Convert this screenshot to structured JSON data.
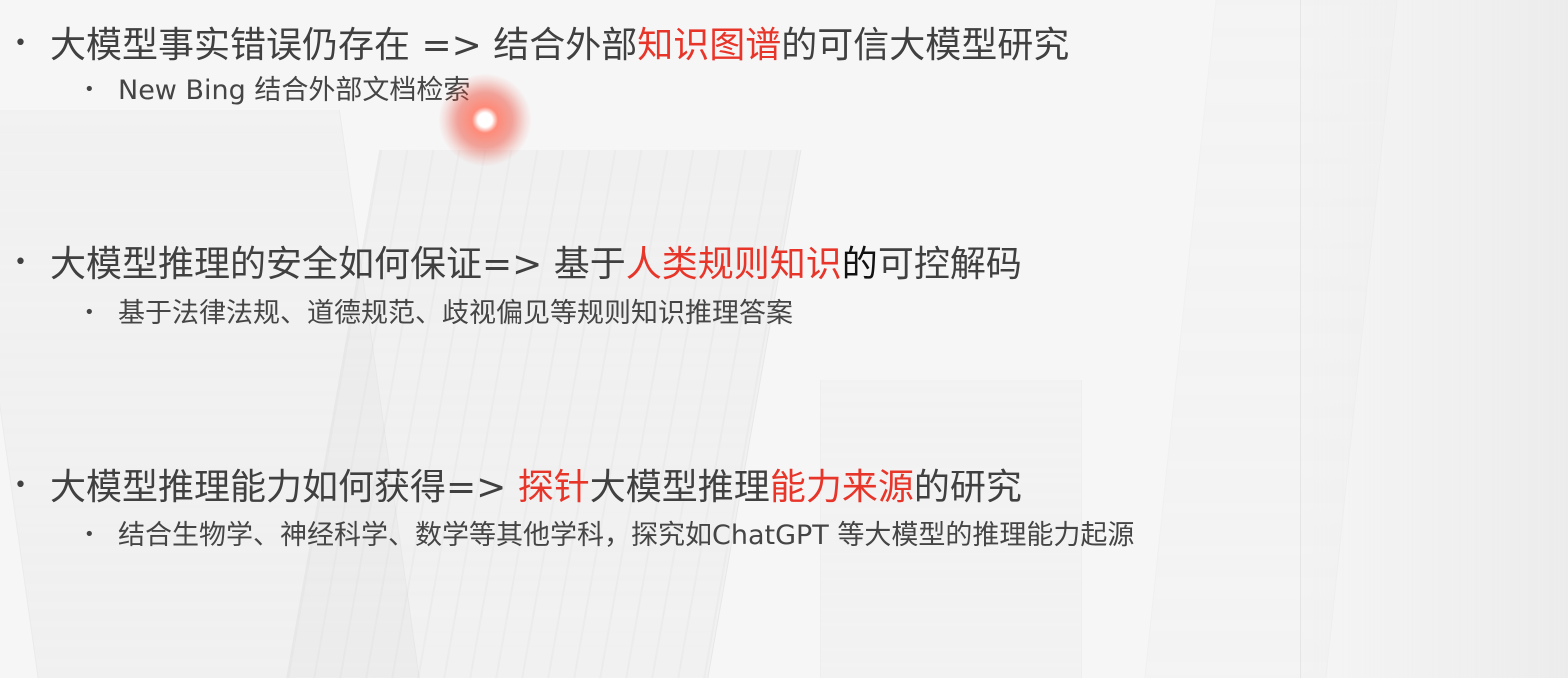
{
  "slide": {
    "items": [
      {
        "main": [
          {
            "text": "大模型事实错误仍存在 => 结合外部",
            "style": "normal"
          },
          {
            "text": "知识图谱",
            "style": "red"
          },
          {
            "text": "的可信大模型研究",
            "style": "normal"
          }
        ],
        "sub": "New  Bing 结合外部文档检索"
      },
      {
        "main": [
          {
            "text": "大模型推理的安全如何保证=> 基于",
            "style": "normal"
          },
          {
            "text": "人类规则知识",
            "style": "red"
          },
          {
            "text": "的",
            "style": "dark"
          },
          {
            "text": "可控解码",
            "style": "normal"
          }
        ],
        "sub": "基于法律法规、道德规范、歧视偏见等规则知识推理答案"
      },
      {
        "main": [
          {
            "text": "大模型推理能力如何获得=> ",
            "style": "normal"
          },
          {
            "text": "探针",
            "style": "red"
          },
          {
            "text": "大模型推理",
            "style": "normal"
          },
          {
            "text": "能力来源",
            "style": "red"
          },
          {
            "text": "的研究",
            "style": "normal"
          }
        ],
        "sub": "结合生物学、神经科学、数学等其他学科，探究如ChatGPT 等大模型的推理能力起源"
      }
    ],
    "bullet_char": "•"
  },
  "colors": {
    "text": "#404040",
    "accent_red": "#e8352a",
    "background": "#f6f6f6",
    "laser_pointer": "#e8352a"
  }
}
